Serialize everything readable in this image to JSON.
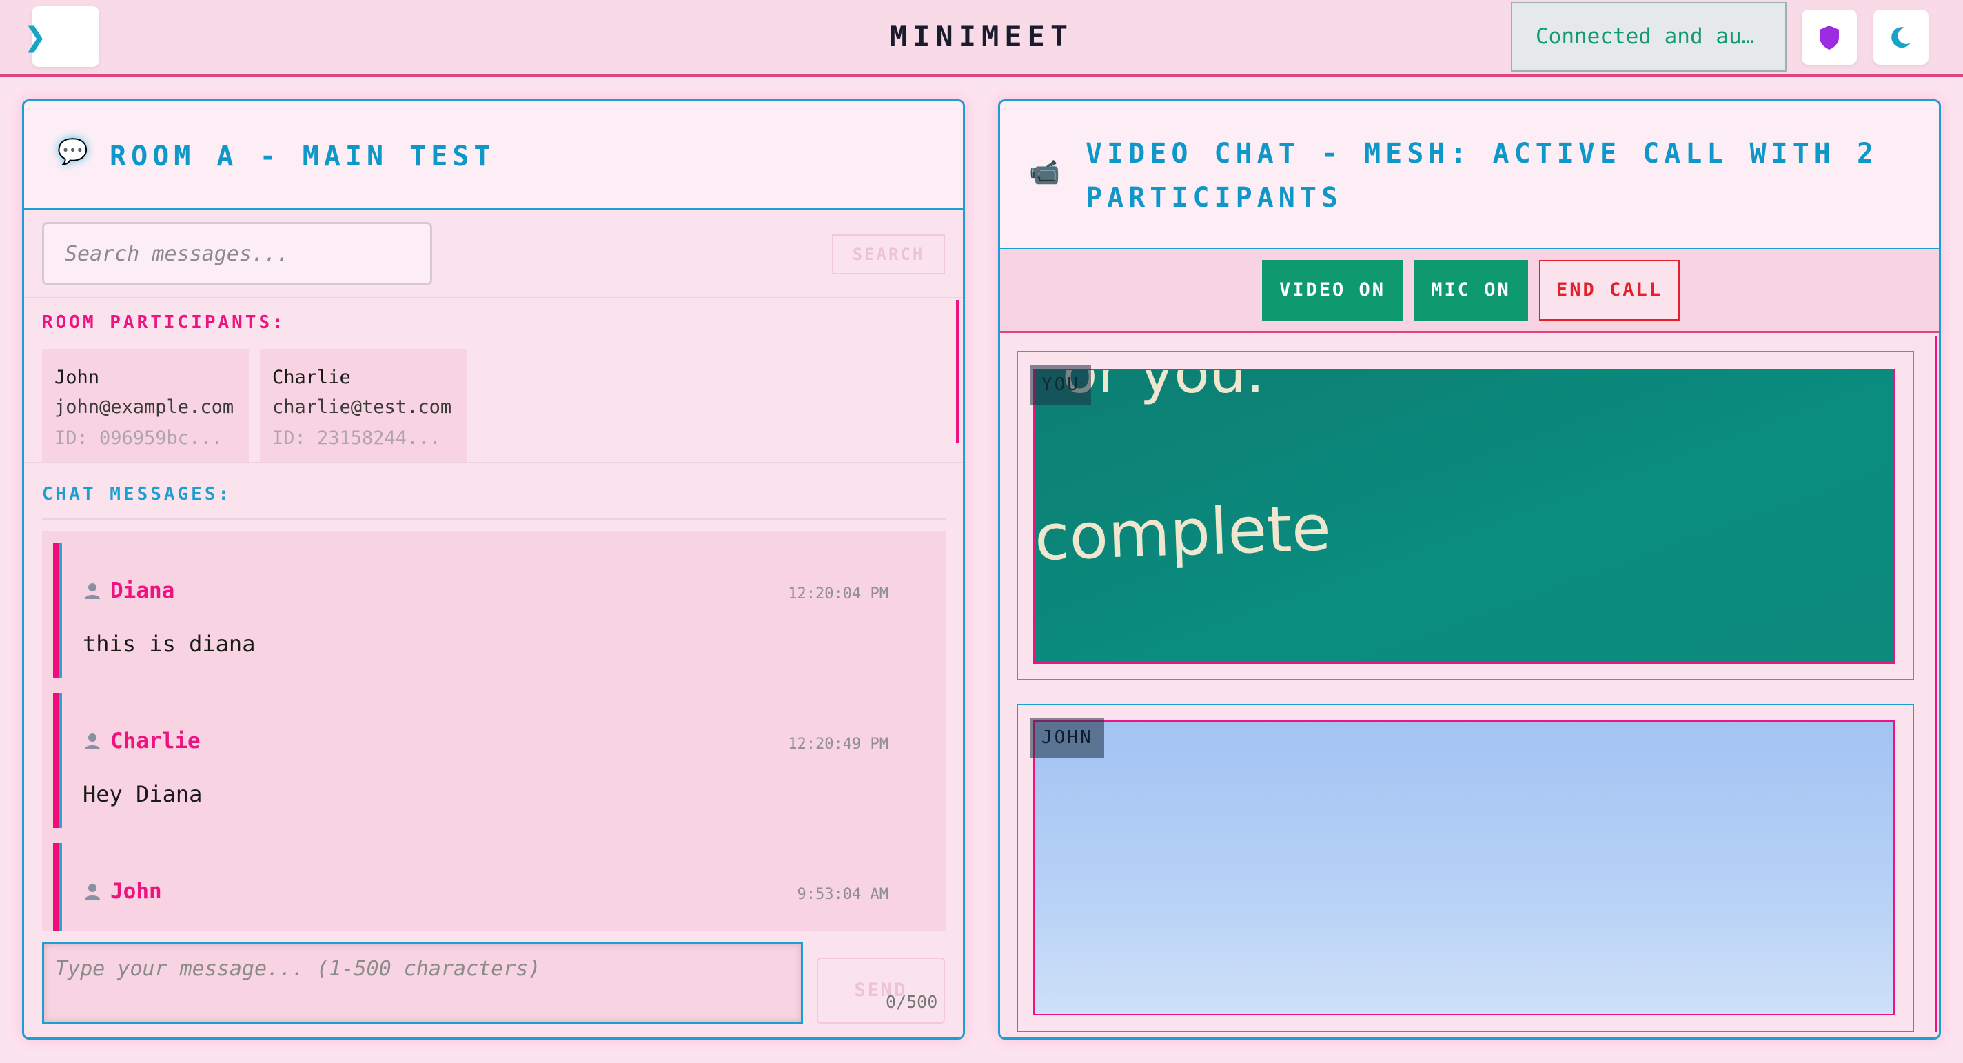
{
  "header": {
    "sidebar_toggle_icon": "chevron-right-icon",
    "title": "MINIMEET",
    "status": "Connected and au…",
    "shield_icon": "shield-icon",
    "theme_icon": "moon-icon"
  },
  "chat_panel": {
    "title": "ROOM A - MAIN TEST",
    "title_icon": "speech-bubble-icon",
    "search": {
      "placeholder": "Search messages...",
      "button": "SEARCH"
    },
    "participants_label": "ROOM PARTICIPANTS:",
    "participants": [
      {
        "name": "John",
        "email": "john@example.com",
        "id": "ID: 096959bc..."
      },
      {
        "name": "Charlie",
        "email": "charlie@test.com",
        "id": "ID: 23158244..."
      }
    ],
    "messages_label": "CHAT MESSAGES:",
    "messages": [
      {
        "author": "Diana",
        "time": "12:20:04 PM",
        "text": "this is diana"
      },
      {
        "author": "Charlie",
        "time": "12:20:49 PM",
        "text": "Hey Diana"
      },
      {
        "author": "John",
        "time": "9:53:04 AM",
        "text": ""
      }
    ],
    "input": {
      "placeholder": "Type your message... (1-500 characters)",
      "send": "SEND",
      "counter": "0/500"
    }
  },
  "video_panel": {
    "title_line1": "VIDEO CHAT - MESH: ACTIVE CALL WITH 2",
    "title_line2": "PARTICIPANTS",
    "title_icon": "video-camera-icon",
    "controls": {
      "video": "VIDEO ON",
      "mic": "MIC ON",
      "end": "END CALL"
    },
    "tiles": [
      {
        "label": "YOU",
        "frame_text_top": "or you.",
        "frame_text_main": "complete"
      },
      {
        "label": "JOHN"
      }
    ]
  },
  "colors": {
    "accent_blue": "#1b9fd0",
    "accent_pink": "#ee1480",
    "success_green": "#0e9a6e",
    "danger_red": "#e5202a"
  }
}
